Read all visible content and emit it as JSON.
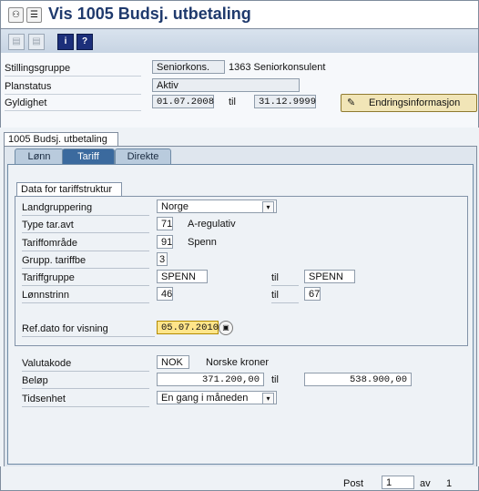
{
  "window": {
    "title": "Vis 1005 Budsj. utbetaling"
  },
  "header": {
    "stillingsgruppe": {
      "label": "Stillingsgruppe",
      "code": "Seniorkons.",
      "text": "1363 Seniorkonsulent"
    },
    "planstatus": {
      "label": "Planstatus",
      "value": "Aktiv"
    },
    "gyldighet": {
      "label": "Gyldighet",
      "from": "01.07.2008",
      "til_label": "til",
      "to": "31.12.9999"
    },
    "endring_button": "Endringsinformasjon"
  },
  "section_title": "1005 Budsj. utbetaling",
  "tabs": [
    {
      "label": "Lønn"
    },
    {
      "label": "Tariff"
    },
    {
      "label": "Direkte"
    }
  ],
  "tariff_group": {
    "title": "Data for tariffstruktur",
    "landgruppering": {
      "label": "Landgruppering",
      "value": "Norge"
    },
    "type_tar_avt": {
      "label": "Type tar.avt",
      "value": "71",
      "text": "A-regulativ"
    },
    "tariffomrade": {
      "label": "Tariffområde",
      "value": "91",
      "text": "Spenn"
    },
    "grupp_tariffbe": {
      "label": "Grupp. tariffbe",
      "value": "3"
    },
    "tariffgruppe": {
      "label": "Tariffgruppe",
      "value": "SPENN",
      "til_label": "til",
      "to": "SPENN"
    },
    "lonnstrinn": {
      "label": "Lønnstrinn",
      "value": "46",
      "til_label": "til",
      "to": "67"
    },
    "refdato": {
      "label": "Ref.dato for visning",
      "value": "05.07.2010"
    }
  },
  "bottom": {
    "valutakode": {
      "label": "Valutakode",
      "value": "NOK",
      "text": "Norske kroner"
    },
    "belop": {
      "label": "Beløp",
      "value": "371.200,00",
      "til_label": "til",
      "to": "538.900,00"
    },
    "tidsenhet": {
      "label": "Tidsenhet",
      "value": "En gang i måneden"
    }
  },
  "footer": {
    "post_label": "Post",
    "post_value": "1",
    "av_label": "av",
    "total": "1"
  },
  "icons": {
    "toolbar": [
      "glasses-icon",
      "menu-icon",
      "prev-icon",
      "next-icon",
      "info-icon",
      "help-icon",
      "endring-icon",
      "calendar-icon",
      "dropdown-icon"
    ]
  },
  "colors": {
    "title": "#1f3a6d",
    "active_tab": "#3b6a9e",
    "endring_button": "#f1e5b7",
    "focus_field": "#ffe58a"
  }
}
